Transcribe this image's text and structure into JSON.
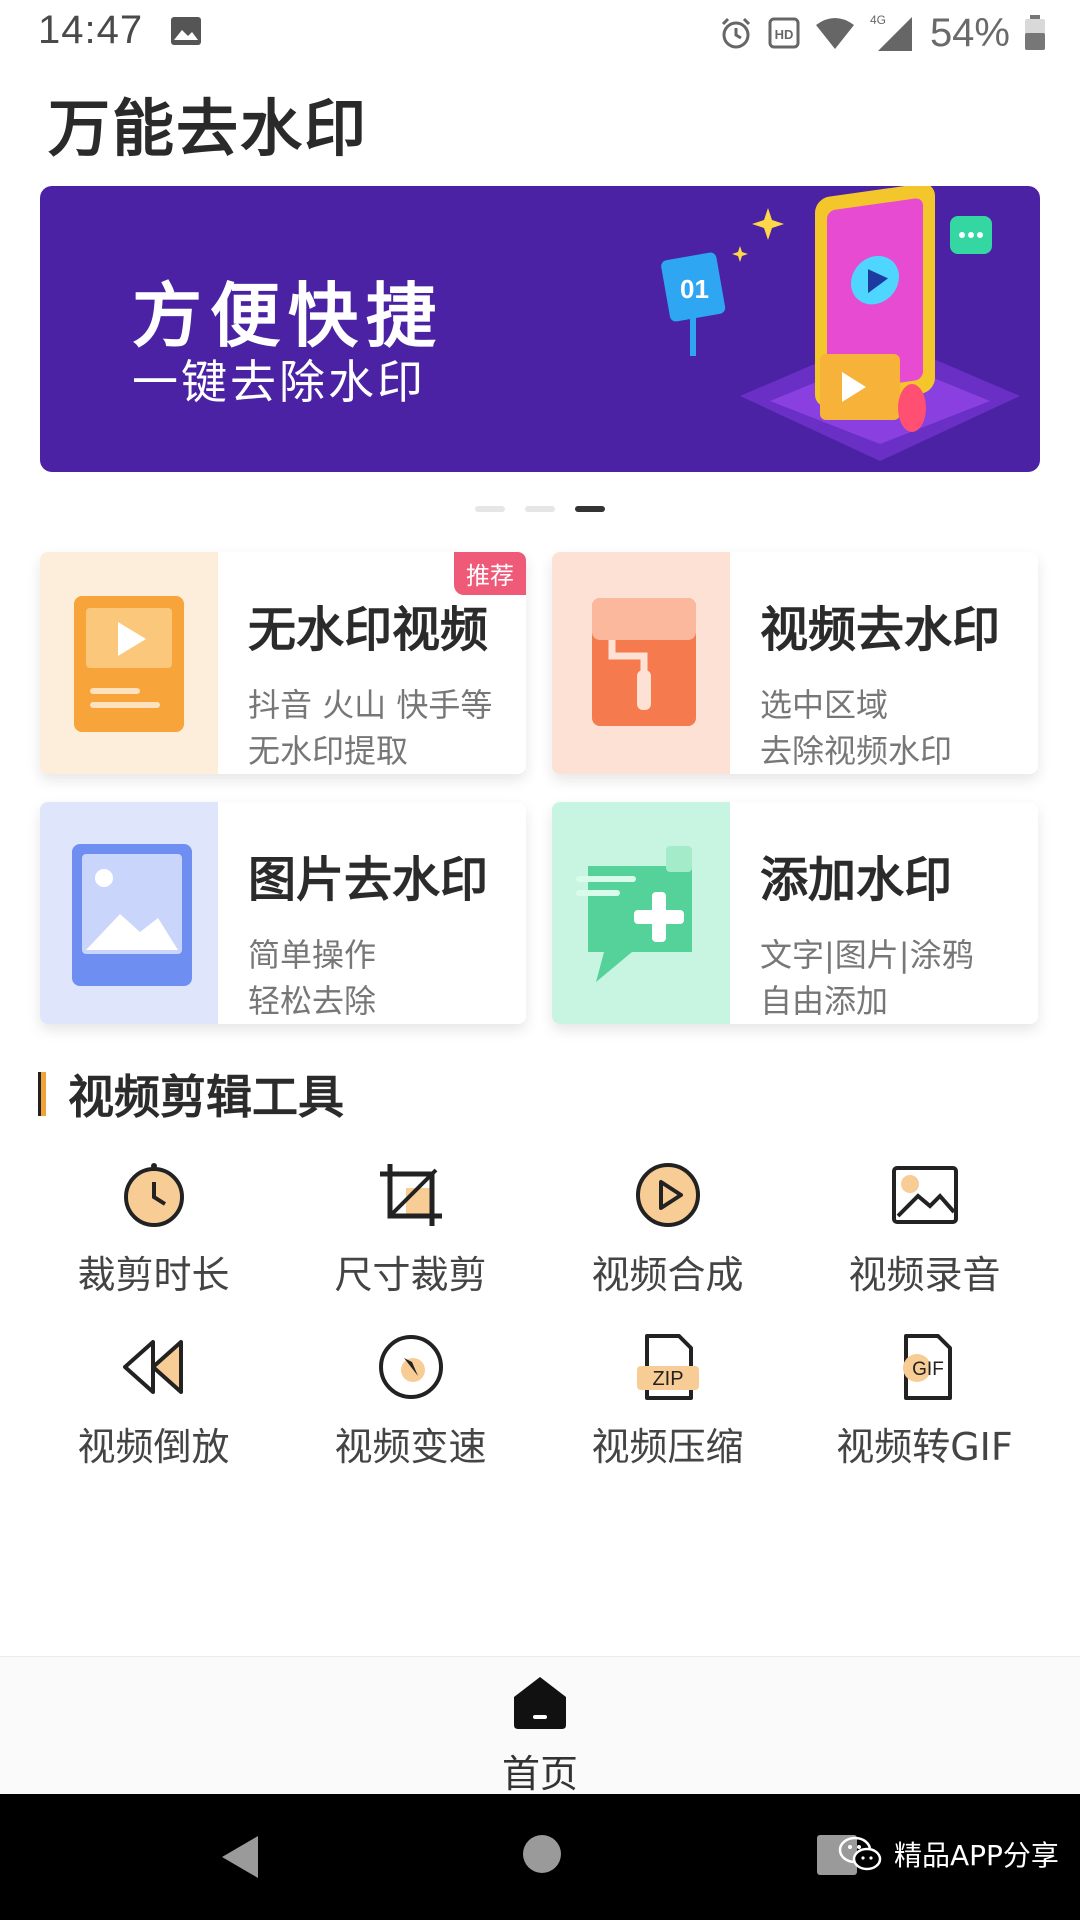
{
  "status_bar": {
    "time": "14:47",
    "battery_percent": "54%",
    "network_label": "4G",
    "hd_label": "HD",
    "icons": [
      "image-icon",
      "alarm-icon",
      "hd-icon",
      "wifi-icon",
      "signal-icon",
      "battery-icon"
    ]
  },
  "app": {
    "title": "万能去水印"
  },
  "banner": {
    "headline": "方便快捷",
    "subline": "一键去除水印",
    "sign_text": "01",
    "page_count": 3,
    "active_page": 3
  },
  "features": [
    {
      "title": "无水印视频",
      "desc1": "抖音 火山 快手等",
      "desc2": "无水印提取",
      "tag": "推荐",
      "icon": "video-play-icon",
      "accent": "#f7a43a"
    },
    {
      "title": "视频去水印",
      "desc1": "选中区域",
      "desc2": "去除视频水印",
      "icon": "paint-roller-icon",
      "accent": "#f57a4e"
    },
    {
      "title": "图片去水印",
      "desc1": "简单操作",
      "desc2": "轻松去除",
      "icon": "picture-icon",
      "accent": "#6e8ff1"
    },
    {
      "title": "添加水印",
      "desc1": "文字|图片|涂鸦",
      "desc2": "自由添加",
      "icon": "add-chat-icon",
      "accent": "#54d29a"
    }
  ],
  "section": {
    "title": "视频剪辑工具"
  },
  "tools": [
    {
      "label": "裁剪时长",
      "icon": "clock-icon"
    },
    {
      "label": "尺寸裁剪",
      "icon": "crop-icon"
    },
    {
      "label": "视频合成",
      "icon": "play-circle-icon"
    },
    {
      "label": "视频录音",
      "icon": "image-record-icon"
    },
    {
      "label": "视频倒放",
      "icon": "rewind-icon"
    },
    {
      "label": "视频变速",
      "icon": "speed-icon"
    },
    {
      "label": "视频压缩",
      "icon": "zip-icon"
    },
    {
      "label": "视频转GIF",
      "icon": "gif-icon"
    }
  ],
  "zip_badge": "ZIP",
  "gif_badge": "GIF",
  "bottom_nav": {
    "home_label": "首页"
  },
  "watermark": {
    "text": "精品APP分享"
  },
  "colors": {
    "banner_bg": "#4a22a3",
    "tag_bg": "#ee5a78",
    "accent_orange": "#f2a23a",
    "tool_fill": "#f7cc95"
  }
}
